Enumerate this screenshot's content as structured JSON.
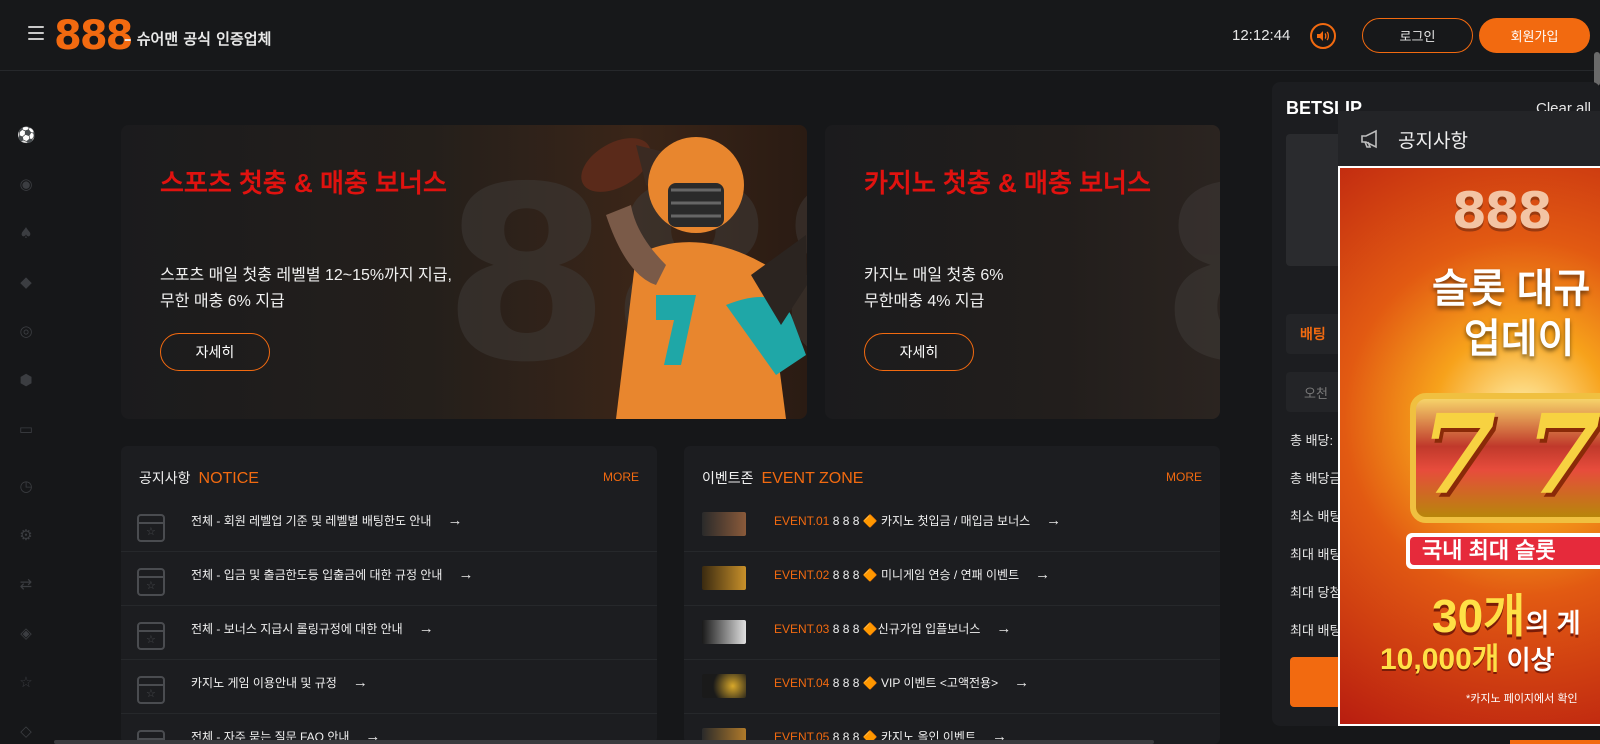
{
  "header": {
    "logo": "888",
    "tagline": "– 슈어맨 공식 인증업체",
    "time": "12:12:44",
    "login_label": "로그인",
    "signup_label": "회원가입"
  },
  "rail": {
    "icons": [
      "sports-icon",
      "live-icon",
      "casino-icon",
      "slot-icon",
      "minigame-icon",
      "virtual-icon",
      "tv-icon",
      "history-icon",
      "settings-icon",
      "transfer-icon",
      "coupon-icon",
      "favorite-icon",
      "vip-icon"
    ]
  },
  "banners": [
    {
      "title": "스포츠 첫충 & 매충 보너스",
      "line1": "스포츠 매일 첫충 레벨별 12~15%까지 지급,",
      "line2": "무한 매충 6% 지급",
      "button": "자세히",
      "watermark": "888"
    },
    {
      "title": "카지노 첫충 & 매충 보너스",
      "line1": "카지노 매일 첫충 6%",
      "line2": "무한매충 4% 지급",
      "button": "자세히",
      "watermark": "8"
    }
  ],
  "notice": {
    "title": "공지사항",
    "title_en": "NOTICE",
    "more": "MORE",
    "items": [
      "전체 - 회원 레벨업 기준 및 레벨별 배팅한도 안내",
      "전체 - 입금 및 출금한도등 입출금에 대한 규정 안내",
      "전체 - 보너스 지급시 롤링규정에 대한 안내",
      "카지노 게임 이용안내 및 규정",
      "전체 - 자주 묻는 질문 FAQ 안내"
    ]
  },
  "events": {
    "title": "이벤트존",
    "title_en": "EVENT ZONE",
    "more": "MORE",
    "items": [
      {
        "label": "EVENT.01",
        "text": "8 8 8 🔶 카지노 첫입금 / 매입금 보너스"
      },
      {
        "label": "EVENT.02",
        "text": "8 8 8 🔶 미니게임 연승 / 연패 이벤트"
      },
      {
        "label": "EVENT.03",
        "text": "8 8 8 🔶신규가입 입플보너스"
      },
      {
        "label": "EVENT.04",
        "text": "8 8 8 🔶 VIP 이벤트 <고액전용>"
      },
      {
        "label": "EVENT.05",
        "text": "8 8 8 🔶 카지노 올인 이벤트"
      }
    ]
  },
  "betslip": {
    "title": "BETSLIP",
    "clear": "Clear all",
    "tab": "배팅",
    "input_placeholder": "오천",
    "lines": [
      "총 배당:",
      "총 배당금",
      "최소 배팅",
      "최대 배팅",
      "최대 당첨",
      "최대 배팅"
    ]
  },
  "popup": {
    "title": "공지사항",
    "image": {
      "logo": "888",
      "line1": "슬롯 대규",
      "line2": "업데이",
      "sevens": "77",
      "badge": "국내 최대 슬롯",
      "count": "30개",
      "count_suffix": "의 게",
      "games": "10,000개",
      "games_suffix": " 이상",
      "footnote": "*카지노 페이지에서  확인"
    }
  },
  "colors": {
    "accent": "#f26a10",
    "banner_title": "#e0120f",
    "background": "#161719"
  }
}
